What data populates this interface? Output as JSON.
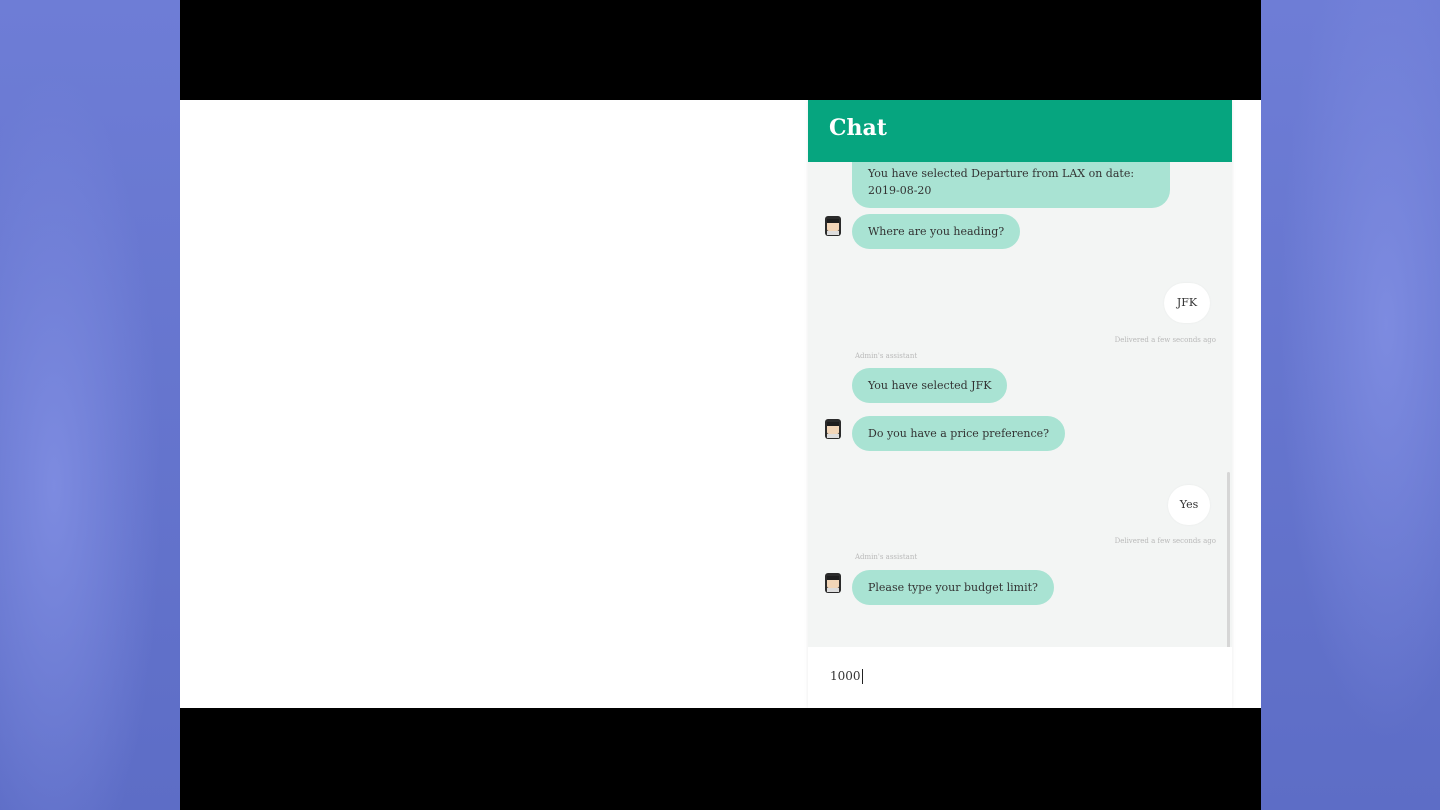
{
  "chat": {
    "title": "Chat",
    "messages": [
      {
        "role": "bot",
        "text": "You have selected Departure from LAX on date: 2019-08-20"
      },
      {
        "role": "bot",
        "text": "Where are you heading?"
      },
      {
        "role": "user",
        "text": "JFK",
        "meta": "Delivered a few seconds ago"
      },
      {
        "role": "bot",
        "sender": "Admin's assistant",
        "text": "You have selected JFK"
      },
      {
        "role": "bot",
        "text": "Do you have a price preference?"
      },
      {
        "role": "user",
        "text": "Yes",
        "meta": "Delivered a few seconds ago"
      },
      {
        "role": "bot",
        "sender": "Admin's assistant",
        "text": "Please type your budget limit?"
      }
    ],
    "input_value": "1000"
  },
  "colors": {
    "header": "#06a57f",
    "bot_bubble": "#a9e3d3",
    "user_bubble": "#ffffff"
  },
  "icons": {
    "avatar": "robot-avatar-icon"
  }
}
